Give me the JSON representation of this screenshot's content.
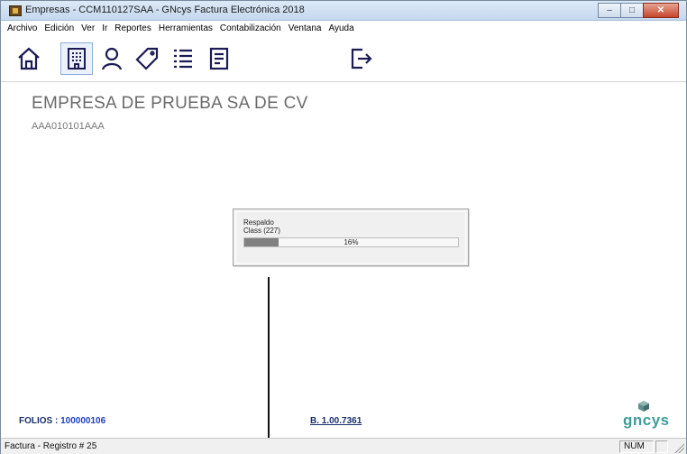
{
  "window": {
    "title": "Empresas - CCM110127SAA - GNcys Factura Electrónica 2018",
    "controls": {
      "minimize": "‒",
      "maximize": "□",
      "close": "✕"
    }
  },
  "menu": [
    "Archivo",
    "Edición",
    "Ver",
    "Ir",
    "Reportes",
    "Herramientas",
    "Contabilización",
    "Ventana",
    "Ayuda"
  ],
  "toolbar": {
    "buttons": [
      {
        "icon": "home-icon",
        "active": false
      },
      {
        "icon": "building-icon",
        "active": true
      },
      {
        "icon": "user-icon",
        "active": false
      },
      {
        "icon": "tag-icon",
        "active": false
      },
      {
        "icon": "list-icon",
        "active": false
      },
      {
        "icon": "document-icon",
        "active": false
      },
      {
        "icon": "exit-icon",
        "active": false
      }
    ]
  },
  "company": {
    "name": "EMPRESA DE PRUEBA SA DE CV",
    "rfc": "AAA010101AAA"
  },
  "progress": {
    "line1": "Respaldo",
    "line2": "Class (227)",
    "percent_label": "16%",
    "fraction": 0.16
  },
  "footer": {
    "folios_label": "FOLIOS :",
    "folios_value": "100000106",
    "version": "B. 1.00.7361",
    "logo_text": "gncys"
  },
  "status": {
    "text": "Factura - Registro #     25",
    "num": "NUM"
  },
  "colors": {
    "accent": "#1f3fbf",
    "logo": "#3f9c9a",
    "progress_fill": "#808080"
  }
}
